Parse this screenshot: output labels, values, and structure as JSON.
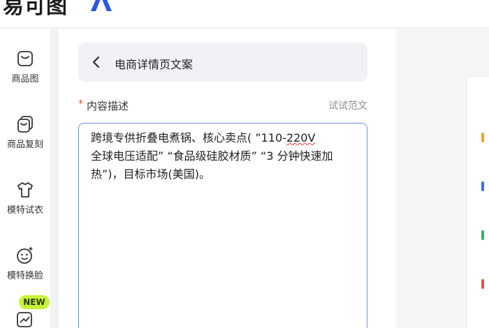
{
  "header": {
    "logo_text": "易可图",
    "logo_mark_color": "#2b55e6"
  },
  "sidebar": {
    "items": [
      {
        "label": "商品图",
        "icon": "bag-icon"
      },
      {
        "label": "商品复刻",
        "icon": "copy-bag-icon"
      },
      {
        "label": "模特试衣",
        "icon": "tshirt-icon"
      },
      {
        "label": "模特换脸",
        "icon": "face-swap-icon"
      },
      {
        "label": "",
        "icon": "edit-image-icon"
      }
    ],
    "new_badge": "NEW"
  },
  "panel": {
    "title": "电商详情页文案",
    "field": {
      "required_mark": "*",
      "label": "内容描述",
      "example_link": "试试范文",
      "value_before": "跨境专供折叠电煮锅、核心卖点( ”110-",
      "value_spell": "220V",
      "value_after": "全球电压适配” “食品级硅胶材质” “3 分钟快速加热”)，目标市场(美国)。"
    }
  },
  "colors": {
    "accent": "#6c8fe6",
    "badge": "#c7f23a",
    "required": "#f0443a",
    "right_marks": [
      "#f5a623",
      "#3d6fe8",
      "#2fb36d",
      "#e8533b"
    ]
  }
}
